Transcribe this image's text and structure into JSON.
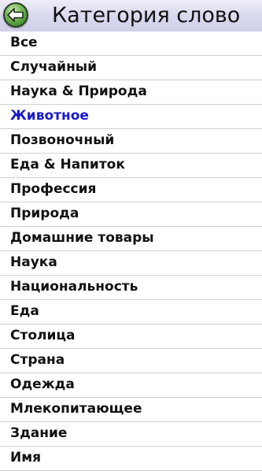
{
  "header": {
    "title": "Категория слово",
    "back_icon": "back-arrow-icon"
  },
  "colors": {
    "header_bg": "#d8d8ee",
    "selected_text": "#1a1acc",
    "text": "#111111",
    "back_button_green": "#3f8a2c"
  },
  "categories": [
    {
      "label": "Все",
      "selected": false
    },
    {
      "label": "Случайный",
      "selected": false
    },
    {
      "label": "Наука & Природа",
      "selected": false
    },
    {
      "label": "Животное",
      "selected": true
    },
    {
      "label": "Позвоночный",
      "selected": false
    },
    {
      "label": "Еда & Напиток",
      "selected": false
    },
    {
      "label": "Профессия",
      "selected": false
    },
    {
      "label": "Природа",
      "selected": false
    },
    {
      "label": "Домашние товары",
      "selected": false
    },
    {
      "label": "Наука",
      "selected": false
    },
    {
      "label": "Национальность",
      "selected": false
    },
    {
      "label": "Еда",
      "selected": false
    },
    {
      "label": "Столица",
      "selected": false
    },
    {
      "label": "Страна",
      "selected": false
    },
    {
      "label": "Одежда",
      "selected": false
    },
    {
      "label": "Млекопитающее",
      "selected": false
    },
    {
      "label": "Здание",
      "selected": false
    },
    {
      "label": "Имя",
      "selected": false
    }
  ]
}
